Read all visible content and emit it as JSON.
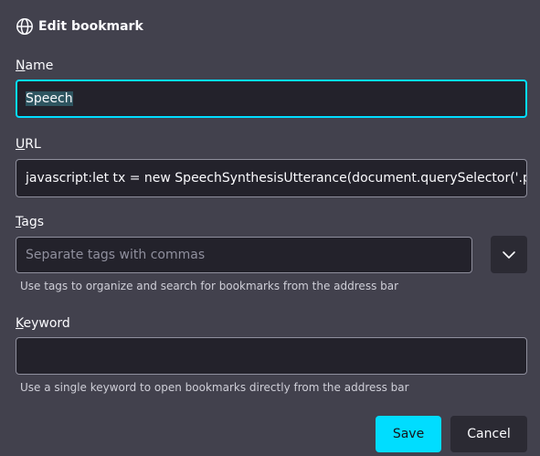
{
  "header": {
    "icon": "globe-icon",
    "title": "Edit bookmark"
  },
  "name": {
    "label_accesskey": "N",
    "label_rest": "ame",
    "value": "Speech"
  },
  "url": {
    "label_accesskey": "U",
    "label_rest": "RL",
    "value": "javascript:let tx = new SpeechSynthesisUtterance(document.querySelector('.post-b"
  },
  "tags": {
    "label_accesskey": "T",
    "label_rest": "ags",
    "placeholder": "Separate tags with commas",
    "dropdown_icon": "chevron-down-icon",
    "hint": "Use tags to organize and search for bookmarks from the address bar"
  },
  "keyword": {
    "label_accesskey": "K",
    "label_rest": "eyword",
    "value": "",
    "hint": "Use a single keyword to open bookmarks directly from the address bar"
  },
  "buttons": {
    "save": "Save",
    "cancel": "Cancel"
  },
  "colors": {
    "background": "#42414d",
    "field_background": "#23222b",
    "accent": "#00ddff",
    "button_background": "#2b2a33",
    "selection": "#2e5560"
  }
}
